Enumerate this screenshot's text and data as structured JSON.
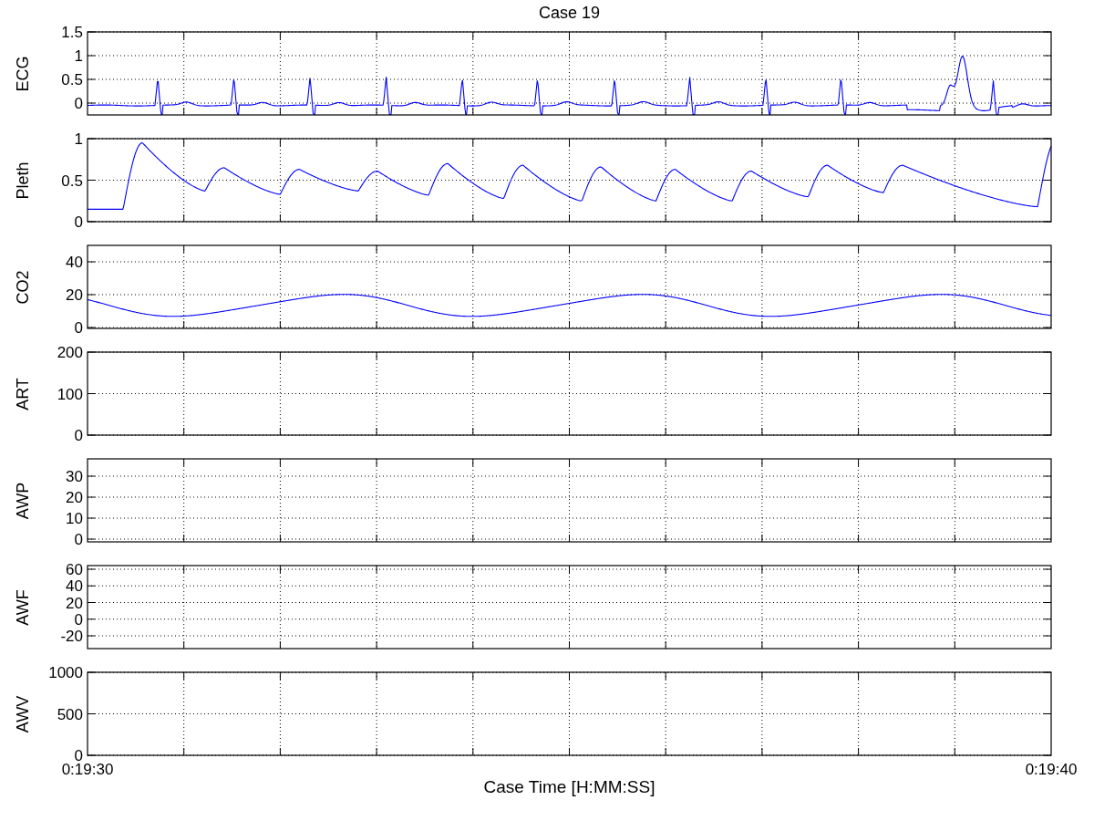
{
  "figure": {
    "title": "Case 19",
    "xlabel": "Case Time [H:MM:SS]"
  },
  "panels": [
    {
      "kind": "ecg",
      "ylabel": "ECG",
      "yticks": [
        "1.5",
        "1",
        "0.5",
        "0"
      ]
    },
    {
      "kind": "pleth",
      "ylabel": "Pleth",
      "yticks": [
        "1",
        "0.5",
        "0"
      ]
    },
    {
      "kind": "co2",
      "ylabel": "CO2",
      "yticks": [
        "40",
        "20",
        "0"
      ]
    },
    {
      "kind": "empty",
      "ylabel": "ART",
      "yticks": [
        "200",
        "100",
        "0"
      ]
    },
    {
      "kind": "empty",
      "ylabel": "AWP",
      "yticks": [
        "30",
        "20",
        "10",
        "0"
      ]
    },
    {
      "kind": "empty",
      "ylabel": "AWF",
      "yticks": [
        "60",
        "40",
        "20",
        "0",
        "-20"
      ]
    },
    {
      "kind": "empty",
      "ylabel": "AWV",
      "yticks": [
        "1000",
        "500",
        "0"
      ],
      "xticks": [
        "0:19:30",
        "0:19:40"
      ]
    }
  ]
}
